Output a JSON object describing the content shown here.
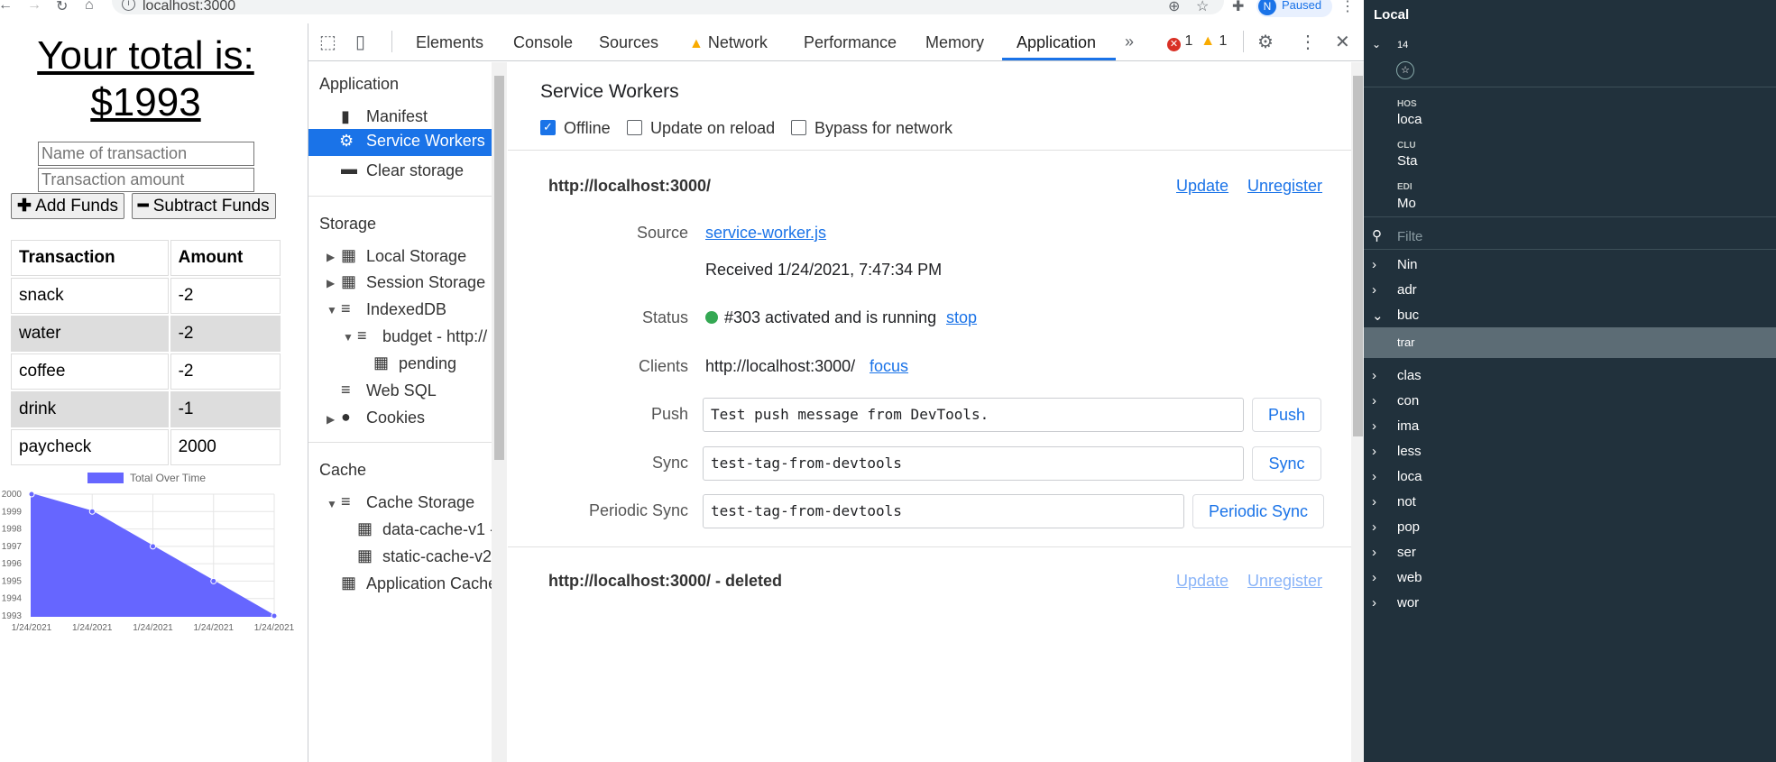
{
  "browser": {
    "url": "localhost:3000",
    "profile_initial": "N",
    "profile_status": "Paused"
  },
  "app": {
    "total_line1": "Your total is:",
    "total_line2": "$1993",
    "name_placeholder": "Name of transaction",
    "amount_placeholder": "Transaction amount",
    "add_label": "Add Funds",
    "subtract_label": "Subtract Funds",
    "table_headers": [
      "Transaction",
      "Amount"
    ],
    "rows": [
      {
        "name": "snack",
        "amount": "-2"
      },
      {
        "name": "water",
        "amount": "-2"
      },
      {
        "name": "coffee",
        "amount": "-2"
      },
      {
        "name": "drink",
        "amount": "-1"
      },
      {
        "name": "paycheck",
        "amount": "2000"
      }
    ]
  },
  "chart_data": {
    "type": "area",
    "legend": "Total Over Time",
    "color": "#6666ff",
    "x": [
      "1/24/2021",
      "1/24/2021",
      "1/24/2021",
      "1/24/2021",
      "1/24/2021"
    ],
    "values": [
      2000,
      1999,
      1997,
      1995,
      1993
    ],
    "yticks": [
      "2000",
      "1999",
      "1998",
      "1997",
      "1996",
      "1995",
      "1994",
      "1993"
    ],
    "ylim": [
      1993,
      2000
    ]
  },
  "devtools": {
    "tabs": [
      "Elements",
      "Console",
      "Sources",
      "Network",
      "Performance",
      "Memory",
      "Application"
    ],
    "active_tab": "Application",
    "error_count": "1",
    "warning_count": "1",
    "sidebar": {
      "application_header": "Application",
      "manifest": "Manifest",
      "service_workers": "Service Workers",
      "clear_storage": "Clear storage",
      "storage_header": "Storage",
      "local_storage": "Local Storage",
      "session_storage": "Session Storage",
      "indexeddb": "IndexedDB",
      "budget": "budget - http://",
      "pending": "pending",
      "websql": "Web SQL",
      "cookies": "Cookies",
      "cache_header": "Cache",
      "cache_storage": "Cache Storage",
      "data_cache": "data-cache-v1 -",
      "static_cache": "static-cache-v2",
      "app_cache": "Application Cache"
    },
    "sw": {
      "title": "Service Workers",
      "offline": "Offline",
      "update_on_reload": "Update on reload",
      "bypass": "Bypass for network",
      "origin": "http://localhost:3000/",
      "update": "Update",
      "unregister": "Unregister",
      "source_label": "Source",
      "source_link": "service-worker.js",
      "received": "Received 1/24/2021, 7:47:34 PM",
      "status_label": "Status",
      "status_text": "#303 activated and is running",
      "stop": "stop",
      "clients_label": "Clients",
      "clients_val": "http://localhost:3000/",
      "focus": "focus",
      "push_label": "Push",
      "push_value": "Test push message from DevTools.",
      "push_btn": "Push",
      "sync_label": "Sync",
      "sync_value": "test-tag-from-devtools",
      "sync_btn": "Sync",
      "psync_label": "Periodic Sync",
      "psync_value": "test-tag-from-devtools",
      "psync_btn": "Periodic Sync",
      "deleted_origin": "http://localhost:3000/ - deleted"
    }
  },
  "right_panel": {
    "title": "Local",
    "r1": "14",
    "host_lbl": "HOS",
    "host_val": "loca",
    "clu_lbl": "CLU",
    "clu_val": "Sta",
    "edi_lbl": "EDI",
    "edi_val": "Mo",
    "filter": "Filte",
    "items": [
      "Nin",
      "adr",
      "buc",
      "trar",
      "clas",
      "con",
      "ima",
      "less",
      "loca",
      "not",
      "pop",
      "ser",
      "web",
      "wor"
    ]
  }
}
